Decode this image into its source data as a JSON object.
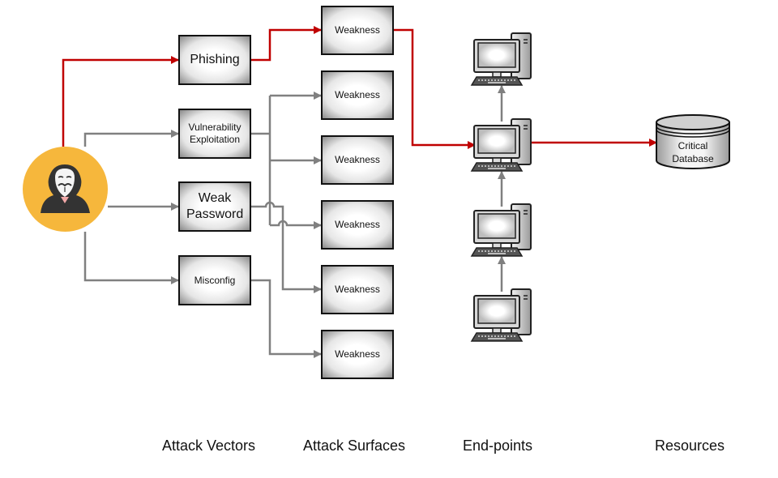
{
  "colors": {
    "attack_path": "#c00000",
    "other_path": "#808080",
    "attacker_circle": "#f6b73c"
  },
  "attacker": {
    "icon": "hacker-anonymous-mask-icon"
  },
  "attack_vectors": [
    {
      "label": "Phishing",
      "on_attack_path": true
    },
    {
      "label": "Vulnerability Exploitation",
      "on_attack_path": false
    },
    {
      "label": "Weak Password",
      "on_attack_path": false
    },
    {
      "label": "Misconfig",
      "on_attack_path": false
    }
  ],
  "attack_surfaces": [
    {
      "label": "Weakness",
      "on_attack_path": true
    },
    {
      "label": "Weakness",
      "on_attack_path": false
    },
    {
      "label": "Weakness",
      "on_attack_path": false
    },
    {
      "label": "Weakness",
      "on_attack_path": false
    },
    {
      "label": "Weakness",
      "on_attack_path": false
    },
    {
      "label": "Weakness",
      "on_attack_path": false
    }
  ],
  "endpoints": [
    {
      "icon": "desktop-computer-icon",
      "on_attack_path": false
    },
    {
      "icon": "desktop-computer-icon",
      "on_attack_path": true
    },
    {
      "icon": "desktop-computer-icon",
      "on_attack_path": false
    },
    {
      "icon": "desktop-computer-icon",
      "on_attack_path": false
    }
  ],
  "resources": [
    {
      "label": "Critical Database",
      "line1": "Critical",
      "line2": "Database",
      "icon": "database-cylinder-icon"
    }
  ],
  "column_labels": {
    "vectors": "Attack Vectors",
    "surfaces": "Attack Surfaces",
    "endpoints": "End-points",
    "resources": "Resources"
  },
  "connections": [
    {
      "from": "attacker",
      "to": "Phishing",
      "type": "attack_path"
    },
    {
      "from": "attacker",
      "to": "Vulnerability Exploitation",
      "type": "other"
    },
    {
      "from": "attacker",
      "to": "Weak Password",
      "type": "other"
    },
    {
      "from": "attacker",
      "to": "Misconfig",
      "type": "other"
    },
    {
      "from": "Phishing",
      "to": "Weakness 1",
      "type": "attack_path"
    },
    {
      "from": "Vulnerability Exploitation",
      "to": "Weakness 2",
      "type": "other"
    },
    {
      "from": "Vulnerability Exploitation",
      "to": "Weakness 3",
      "type": "other"
    },
    {
      "from": "Vulnerability Exploitation",
      "to": "Weakness 4",
      "type": "other"
    },
    {
      "from": "Weak Password",
      "to": "Weakness 5",
      "type": "other"
    },
    {
      "from": "Misconfig",
      "to": "Weakness 6",
      "type": "other"
    },
    {
      "from": "Weakness 1",
      "to": "Endpoint 2",
      "type": "attack_path"
    },
    {
      "from": "Endpoint 2",
      "to": "Endpoint 1",
      "type": "other"
    },
    {
      "from": "Endpoint 3",
      "to": "Endpoint 2",
      "type": "other"
    },
    {
      "from": "Endpoint 4",
      "to": "Endpoint 3",
      "type": "other"
    },
    {
      "from": "Endpoint 2",
      "to": "Critical Database",
      "type": "attack_path"
    }
  ]
}
